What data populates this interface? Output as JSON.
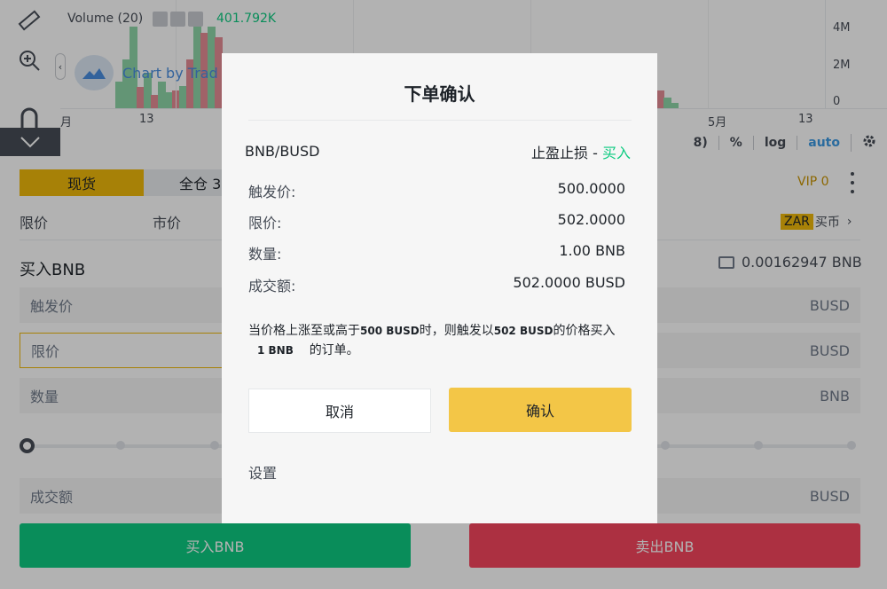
{
  "chart": {
    "volume_label": "Volume (20)",
    "volume_value": "401.792K",
    "watermark": "Chart by Trad",
    "y_ticks": [
      "4M",
      "2M",
      "0"
    ],
    "x_ticks": [
      "月",
      "13",
      "5月",
      "13"
    ],
    "toolbar": [
      "8)",
      "%",
      "log",
      "auto"
    ],
    "colors": {
      "up": "#8fd6a8",
      "down": "#e68d95",
      "accent": "#3d9ae3"
    }
  },
  "trade": {
    "tab_spot": "现货",
    "tab_cross": "全仓 3",
    "vip": "VIP 0",
    "order_types": [
      "限价",
      "市价"
    ],
    "zar_badge": "ZAR",
    "buy_coin": "买币",
    "buy_title": "买入BNB",
    "balance": "0.00162947 BNB",
    "fields": [
      {
        "label": "触发价",
        "unit": "BUSD"
      },
      {
        "label": "限价",
        "unit": "BUSD"
      },
      {
        "label": "数量",
        "unit": "BNB"
      },
      {
        "label": "成交额",
        "unit": "BUSD"
      }
    ],
    "buy_button": "买入BNB",
    "sell_button": "卖出BNB"
  },
  "modal": {
    "title": "下单确认",
    "pair": "BNB/BUSD",
    "kind": "止盈止损 - ",
    "side": "买入",
    "rows": [
      {
        "label": "触发价:",
        "value": "500.0000"
      },
      {
        "label": "限价:",
        "value": "502.0000"
      },
      {
        "label": "数量:",
        "value": "1.00 BNB"
      },
      {
        "label": "成交额:",
        "value": "502.0000 BUSD"
      }
    ],
    "desc": {
      "p1": "当价格上涨至或高于",
      "b1": "500 BUSD",
      "p2": "时，则触发以",
      "b2": "502 BUSD",
      "p3": "的价格买入",
      "b3": "1 BNB",
      "p4": "的订单。"
    },
    "cancel": "取消",
    "confirm": "确认",
    "settings": "设置"
  }
}
